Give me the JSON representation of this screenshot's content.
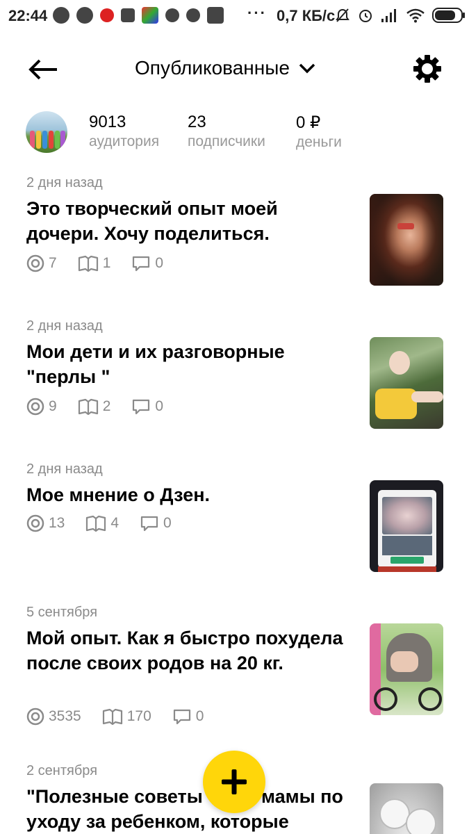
{
  "status_bar": {
    "time": "22:44",
    "dots": "···",
    "speed": "0,7 КБ/с",
    "battery_level": 0.8
  },
  "header": {
    "title": "Опубликованные",
    "icons": [
      "back-arrow-icon",
      "chevron-down-icon",
      "gear-icon"
    ]
  },
  "stats": [
    {
      "value": "9013",
      "label": "аудитория"
    },
    {
      "value": "23",
      "label": "подписчики"
    },
    {
      "value": "0 ₽",
      "label": "деньги"
    }
  ],
  "articles": [
    {
      "date": "2 дня назад",
      "title": "Это творческий опыт моей дочери. Хочу поделиться.",
      "views": "7",
      "reads": "1",
      "comments": "0"
    },
    {
      "date": "2 дня назад",
      "title": "Мои дети и их разговорные \"перлы \"",
      "views": "9",
      "reads": "2",
      "comments": "0"
    },
    {
      "date": "2 дня назад",
      "title": "Мое мнение о Дзен.",
      "views": "13",
      "reads": "4",
      "comments": "0"
    },
    {
      "date": "5 сентября",
      "title": "Мой опыт. Как я быстро похудела после своих родов на 20 кг.",
      "views": "3535",
      "reads": "170",
      "comments": "0"
    },
    {
      "date": "2 сентября",
      "title": "\"Полезные советы      ей мамы по уходу за ребенком, которые",
      "views": "",
      "reads": "",
      "comments": ""
    }
  ],
  "colors": {
    "fab": "#ffd60a",
    "muted_text": "#8a8a8a"
  }
}
